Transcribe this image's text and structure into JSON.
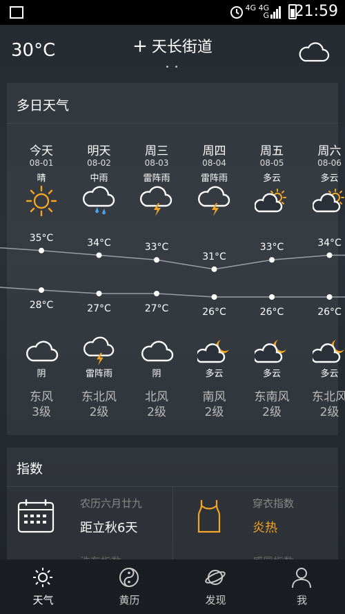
{
  "statusbar": {
    "time": "21:59",
    "network_top": "4G 4G",
    "network_bottom": "G"
  },
  "header": {
    "current_temp": "30°C",
    "location": "天长街道",
    "page_dots": "• •"
  },
  "forecast": {
    "title": "多日天气",
    "days": [
      {
        "name": "今天",
        "date": "08-01",
        "day_cond": "晴",
        "day_icon": "sun-icon",
        "high": "35°C",
        "low": "28°C",
        "night_icon": "cloud-icon",
        "night_cond": "阴",
        "wind_dir": "东风",
        "wind_level": "3级",
        "high_value": 35,
        "low_value": 28
      },
      {
        "name": "明天",
        "date": "08-02",
        "day_cond": "中雨",
        "day_icon": "rain-cloud-icon",
        "high": "34°C",
        "low": "27°C",
        "night_icon": "thunder-cloud-icon",
        "night_cond": "雷阵雨",
        "wind_dir": "东北风",
        "wind_level": "2级",
        "high_value": 34,
        "low_value": 27
      },
      {
        "name": "周三",
        "date": "08-03",
        "day_cond": "雷阵雨",
        "day_icon": "thunder-cloud-icon",
        "high": "33°C",
        "low": "27°C",
        "night_icon": "cloud-icon",
        "night_cond": "阴",
        "wind_dir": "北风",
        "wind_level": "2级",
        "high_value": 33,
        "low_value": 27
      },
      {
        "name": "周四",
        "date": "08-04",
        "day_cond": "雷阵雨",
        "day_icon": "thunder-cloud-icon",
        "high": "31°C",
        "low": "26°C",
        "night_icon": "moon-cloud-icon",
        "night_cond": "多云",
        "wind_dir": "南风",
        "wind_level": "2级",
        "high_value": 31,
        "low_value": 26
      },
      {
        "name": "周五",
        "date": "08-05",
        "day_cond": "多云",
        "day_icon": "sun-cloud-icon",
        "high": "33°C",
        "low": "26°C",
        "night_icon": "moon-cloud-icon",
        "night_cond": "多云",
        "wind_dir": "东南风",
        "wind_level": "2级",
        "high_value": 33,
        "low_value": 26
      },
      {
        "name": "周六",
        "date": "08-06",
        "day_cond": "多云",
        "day_icon": "sun-cloud-icon",
        "high": "34°C",
        "low": "26°C",
        "night_icon": "moon-cloud-icon",
        "night_cond": "多云",
        "wind_dir": "东北风",
        "wind_level": "2级",
        "high_value": 34,
        "low_value": 26
      }
    ]
  },
  "indices": {
    "title": "指数",
    "items": [
      {
        "label": "农历六月廿九",
        "value": "距立秋6天",
        "icon": "calendar-icon"
      },
      {
        "label": "穿衣指数",
        "value": "炎热",
        "icon": "tank-top-icon"
      }
    ],
    "peek": [
      "洗车指数",
      "感冒指数"
    ]
  },
  "tabbar": {
    "tabs": [
      {
        "label": "天气",
        "icon": "sun-icon",
        "active": true
      },
      {
        "label": "黄历",
        "icon": "yin-yang-icon",
        "active": false
      },
      {
        "label": "发现",
        "icon": "planet-icon",
        "active": false
      },
      {
        "label": "我",
        "icon": "user-icon",
        "active": false
      }
    ]
  },
  "colors": {
    "accent": "#f5a623",
    "line": "#9aa0a8",
    "background": "#2b3038"
  }
}
